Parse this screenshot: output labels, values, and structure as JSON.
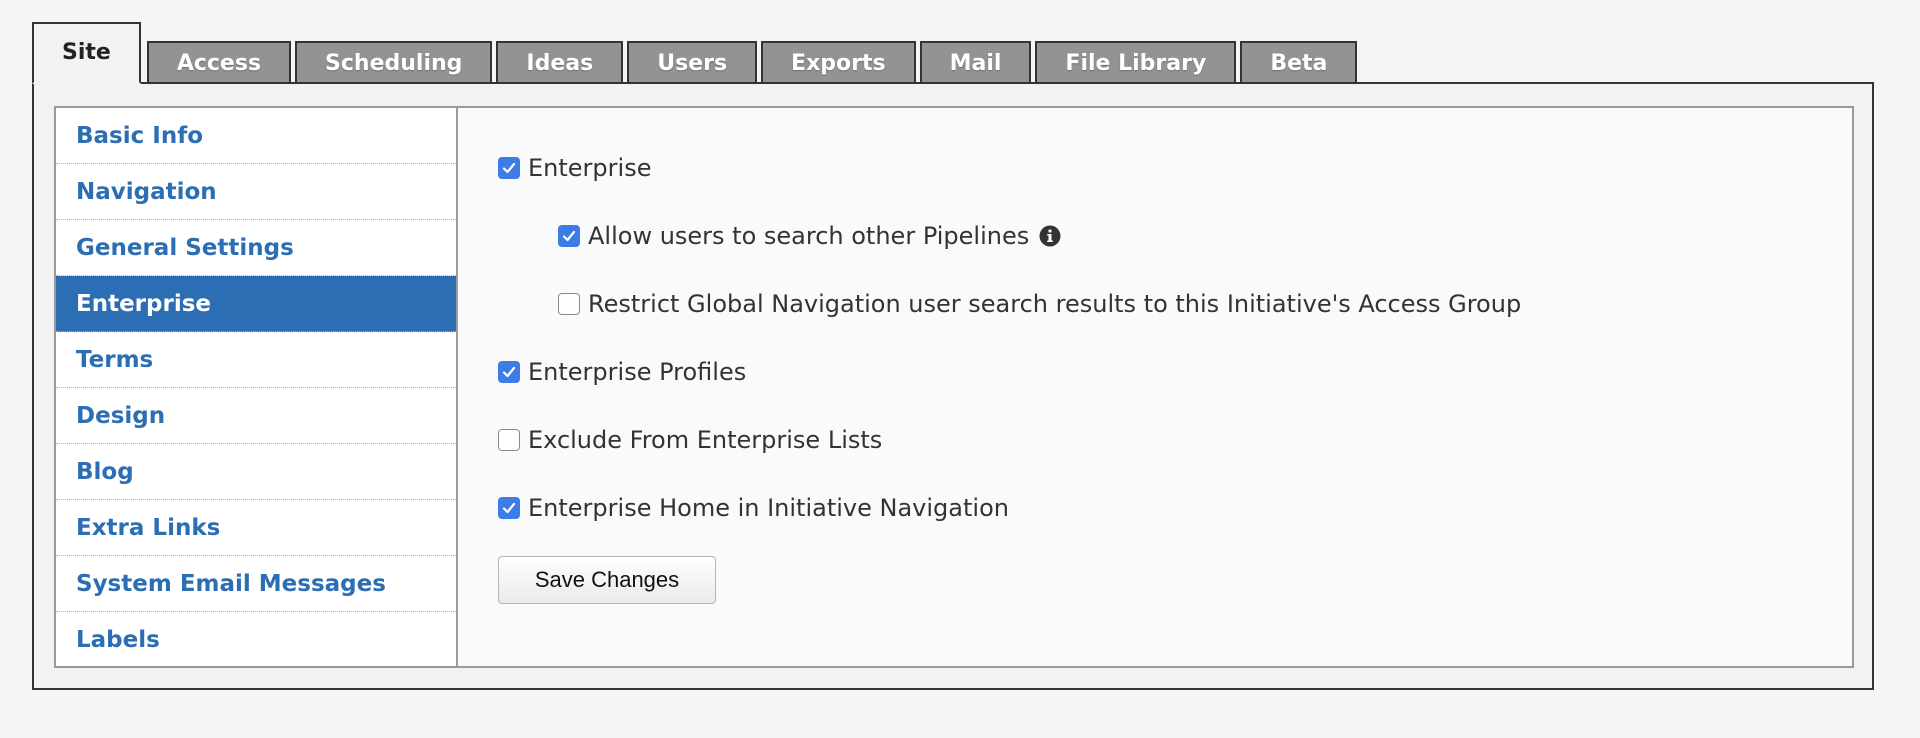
{
  "tabs": [
    {
      "label": "Site",
      "active": true
    },
    {
      "label": "Access"
    },
    {
      "label": "Scheduling"
    },
    {
      "label": "Ideas"
    },
    {
      "label": "Users"
    },
    {
      "label": "Exports"
    },
    {
      "label": "Mail"
    },
    {
      "label": "File Library"
    },
    {
      "label": "Beta"
    }
  ],
  "sidebar": {
    "items": [
      {
        "label": "Basic Info"
      },
      {
        "label": "Navigation"
      },
      {
        "label": "General Settings"
      },
      {
        "label": "Enterprise",
        "active": true
      },
      {
        "label": "Terms"
      },
      {
        "label": "Design"
      },
      {
        "label": "Blog"
      },
      {
        "label": "Extra Links"
      },
      {
        "label": "System Email Messages"
      },
      {
        "label": "Labels"
      }
    ]
  },
  "options": [
    {
      "label": "Enterprise",
      "checked": true
    },
    {
      "label": "Allow users to search other Pipelines",
      "checked": true,
      "info_icon": "info-circle-icon"
    },
    {
      "label": "Restrict Global Navigation user search results to this Initiative's Access Group",
      "checked": false
    },
    {
      "label": "Enterprise Profiles",
      "checked": true
    },
    {
      "label": "Exclude From Enterprise Lists",
      "checked": false
    },
    {
      "label": "Enterprise Home in Initiative Navigation",
      "checked": true
    }
  ],
  "save_button": {
    "label": "Save Changes"
  },
  "colors": {
    "accent": "#2b6eb4",
    "checkbox": "#3d7ce6",
    "tab_inactive": "#939393"
  }
}
